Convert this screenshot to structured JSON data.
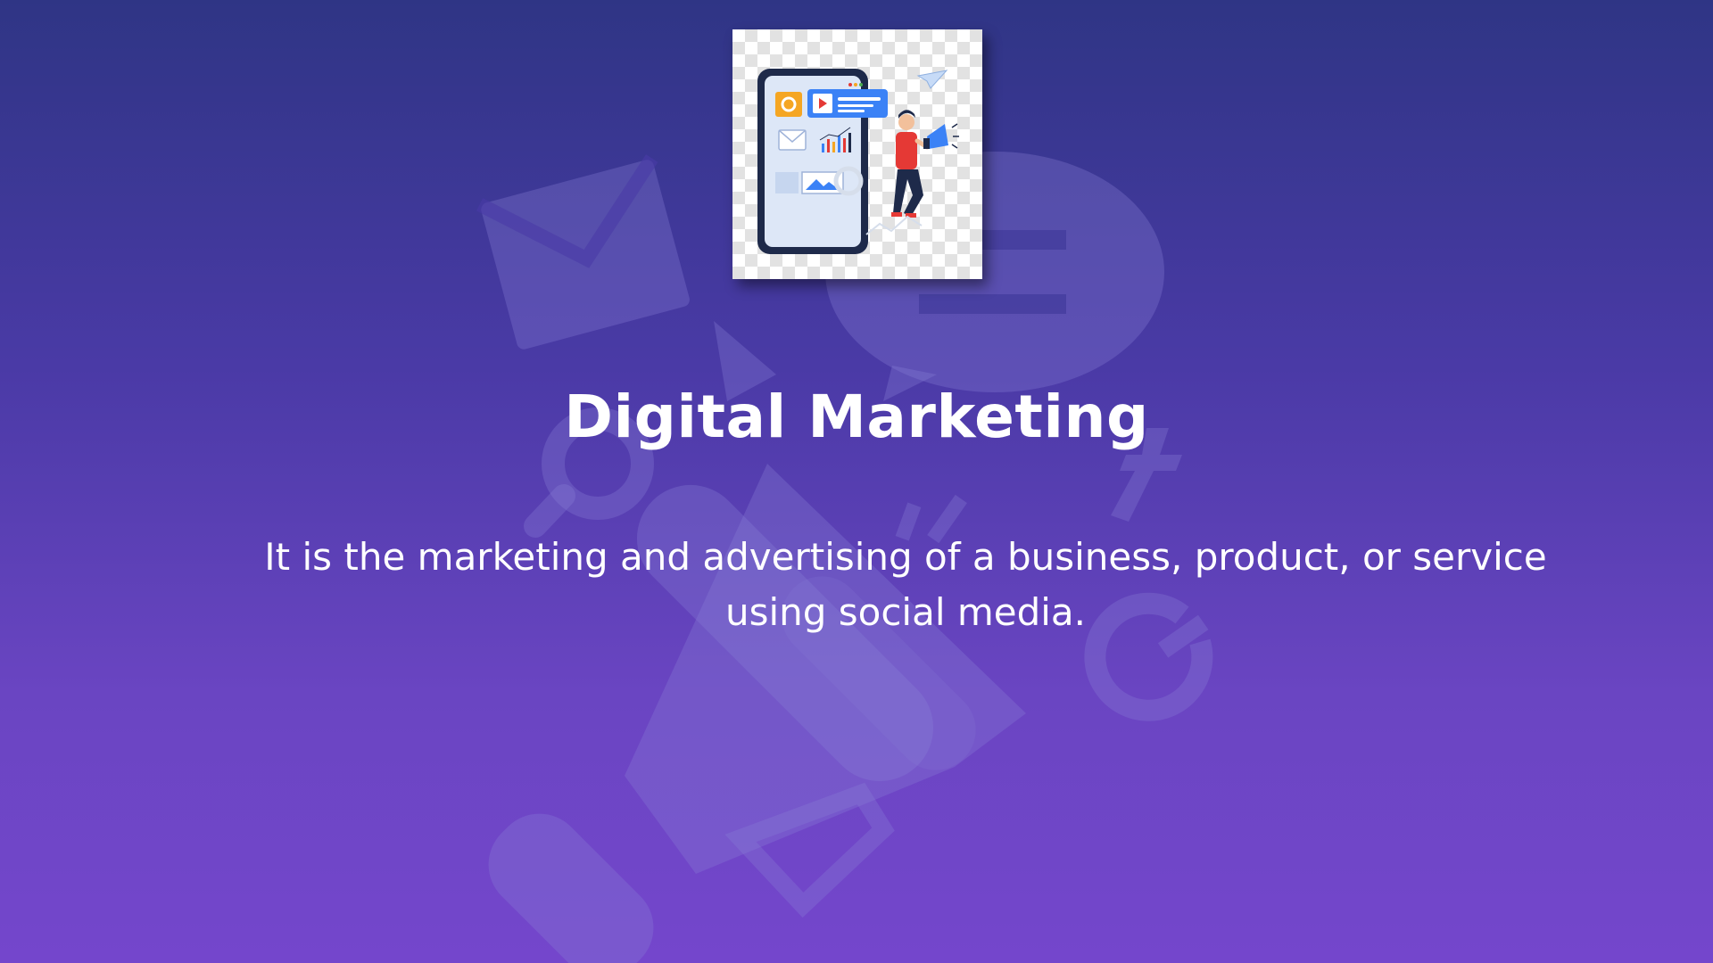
{
  "slide": {
    "title": "Digital Marketing",
    "description": "It is the marketing and advertising of a business, product, or service using social media."
  },
  "illustration": {
    "name": "digital-marketing-illustration",
    "icons": [
      "smartphone-icon",
      "settings-icon",
      "play-icon",
      "mail-icon",
      "bar-chart-icon",
      "image-icon",
      "paper-plane-icon",
      "megaphone-icon",
      "person-icon"
    ]
  },
  "background_icons": [
    "envelope-icon",
    "chat-bubble-icon",
    "megaphone-icon",
    "search-icon",
    "facebook-f-icon",
    "google-g-icon",
    "play-icon"
  ],
  "colors": {
    "background_top": "#2f3585",
    "background_bottom": "#7446cc",
    "text": "#ffffff",
    "accent_blue": "#3b82f6",
    "accent_orange": "#f5a623",
    "accent_red": "#e53935",
    "phone_navy": "#1e2a4a"
  }
}
